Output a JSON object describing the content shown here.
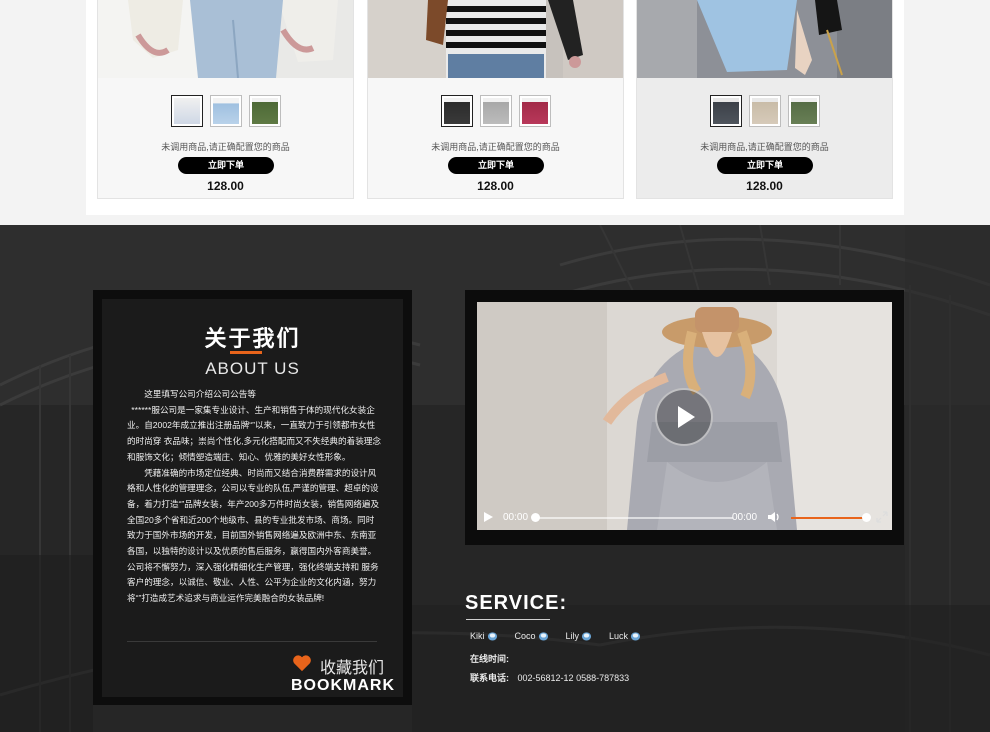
{
  "products": [
    {
      "note": "未调用商品,请正确配置您的商品",
      "buy_label": "立即下单",
      "price": "128.00"
    },
    {
      "note": "未调用商品,请正确配置您的商品",
      "buy_label": "立即下单",
      "price": "128.00"
    },
    {
      "note": "未调用商品,请正确配置您的商品",
      "buy_label": "立即下单",
      "price": "128.00"
    }
  ],
  "about": {
    "title": "关于我们",
    "subtitle": "ABOUT US",
    "paragraphs": [
      "这里填写公司介绍公司公告等",
      "******服公司是一家集专业设计、生产和销售于体的现代化女装企业。自2002年成立推出注册品牌“”以来，一直致力于引领都市女性的时尚穿 衣品味；崇尚个性化,多元化搭配而又不失经典的着装理念和服饰文化；倾情塑造端庄、知心、优雅的美好女性形象。",
      "凭藉准确的市场定位经典、时尚而又结合消费群需求的设计风格和人性化的管理理念，公司以专业的队伍,严谨的管理、超卓的设备，着力打造“”品牌女装，年产200多万件时尚女装，销售网络遍及全国20多个省和近200个地级市、县的专业批发市场、商场。同时致力于国外市场的开发，目前国外销售网络遍及欧洲中东、东南亚各国，以独特的设计以及优质的售后服务，赢得国内外客商美誉。公司将不懈努力，深入强化精细化生产管理，强化终端支持和 服务客户的理念，以诚信、敬业、人性、公平为企业的文化内涵，努力将“”打造成艺术追求与商业运作完美融合的女装品牌!"
    ],
    "bookmark_cn": "收藏我们",
    "bookmark_en": "BOOKMARK"
  },
  "video": {
    "current_time": "00:00",
    "duration": "00:00",
    "progress": 0,
    "volume": 1.0
  },
  "service": {
    "title": "SERVICE:",
    "agents": [
      "Kiki",
      "Coco",
      "Lily",
      "Luck"
    ],
    "online_label": "在线时间:",
    "online_value": "",
    "phone_label": "联系电话:",
    "phone_value": "002-56812-12 0588-787833"
  },
  "colors": {
    "accent": "#e8641b",
    "dark_bg": "#232323",
    "button": "#000000"
  },
  "icons": [
    "play-icon",
    "volume-icon",
    "fullscreen-icon",
    "heart-icon",
    "qq-icon"
  ]
}
